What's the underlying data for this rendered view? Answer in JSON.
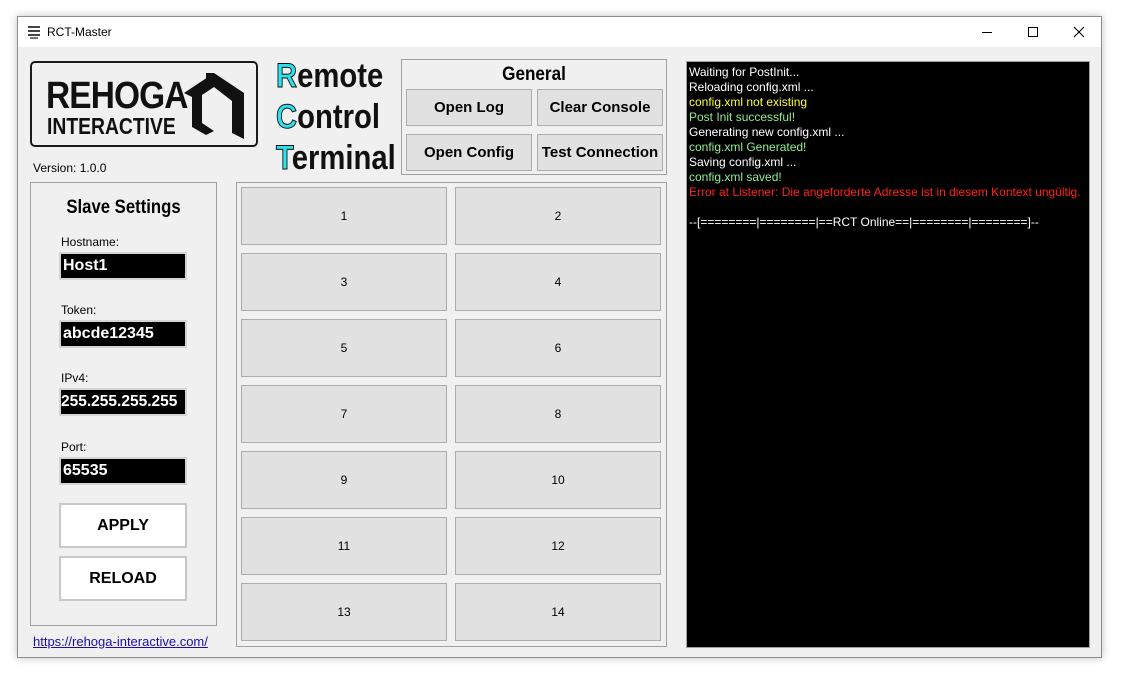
{
  "window": {
    "title": "RCT-Master",
    "controls": [
      "minimize",
      "maximize",
      "close"
    ]
  },
  "logo": {
    "line1": "REHOGA",
    "line2": "INTERACTIVE"
  },
  "app_title": {
    "lines": [
      {
        "cap": "R",
        "rest": "emote"
      },
      {
        "cap": "C",
        "rest": "ontrol"
      },
      {
        "cap": "T",
        "rest": "erminal"
      }
    ],
    "cap_color": "#2ee0ec"
  },
  "version": "Version: 1.0.0",
  "general": {
    "title": "General",
    "open_log": "Open Log",
    "clear_console": "Clear Console",
    "open_config": "Open Config",
    "test_connection": "Test Connection"
  },
  "slave_settings": {
    "title": "Slave Settings",
    "hostname_label": "Hostname:",
    "hostname_value": "Host1",
    "token_label": "Token:",
    "token_value": "abcde12345",
    "ipv4_label": "IPv4:",
    "ipv4_value": "255.255.255.255",
    "port_label": "Port:",
    "port_value": "65535",
    "apply": "APPLY",
    "reload": "RELOAD"
  },
  "link": "https://rehoga-interactive.com/",
  "slots": [
    "1",
    "2",
    "3",
    "4",
    "5",
    "6",
    "7",
    "8",
    "9",
    "10",
    "11",
    "12",
    "13",
    "14"
  ],
  "console": {
    "colors": {
      "white": "#ffffff",
      "yellow": "#ffff33",
      "green": "#90ee90",
      "red": "#ff2020"
    },
    "lines": [
      {
        "text": "Waiting for PostInit...",
        "color": "#ffffff"
      },
      {
        "text": "Reloading config.xml ...",
        "color": "#ffffff"
      },
      {
        "text": "config.xml not existing",
        "color": "#ffff33"
      },
      {
        "text": "Post Init successful!",
        "color": "#90ee90"
      },
      {
        "text": "Generating new config.xml ...",
        "color": "#ffffff"
      },
      {
        "text": "config.xml Generated!",
        "color": "#90ee90"
      },
      {
        "text": "Saving config.xml ...",
        "color": "#ffffff"
      },
      {
        "text": "config.xml saved!",
        "color": "#90ee90"
      },
      {
        "text": "Error at Listener: Die angeforderte Adresse ist in diesem Kontext ungültig.",
        "color": "#ff2020"
      },
      {
        "text": "",
        "color": "#ffffff"
      },
      {
        "text": "--[========|========|==RCT Online==|========|========]--",
        "color": "#ffffff"
      }
    ]
  }
}
